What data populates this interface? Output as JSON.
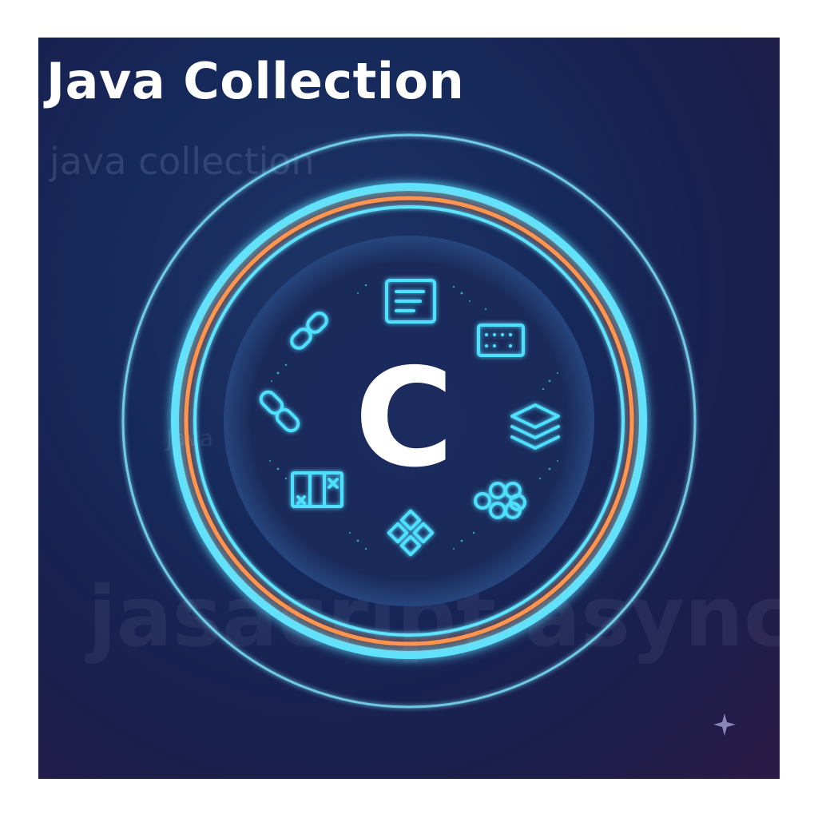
{
  "title": "Java Collection",
  "watermarks": {
    "top": "java collection",
    "left": "Java",
    "bottom": "jasacript async"
  },
  "center_letter": "C",
  "icons": [
    "document-icon",
    "matrix-icon",
    "layers-icon",
    "hexagon-cluster-icon",
    "diamond-grid-icon",
    "map-icon",
    "chain-link-icon",
    "link-icon"
  ],
  "colors": {
    "background": "#16285a",
    "cyan": "#4fe0ff",
    "orange": "#ff8a4a",
    "inner_disk": "#1a2a5c"
  }
}
